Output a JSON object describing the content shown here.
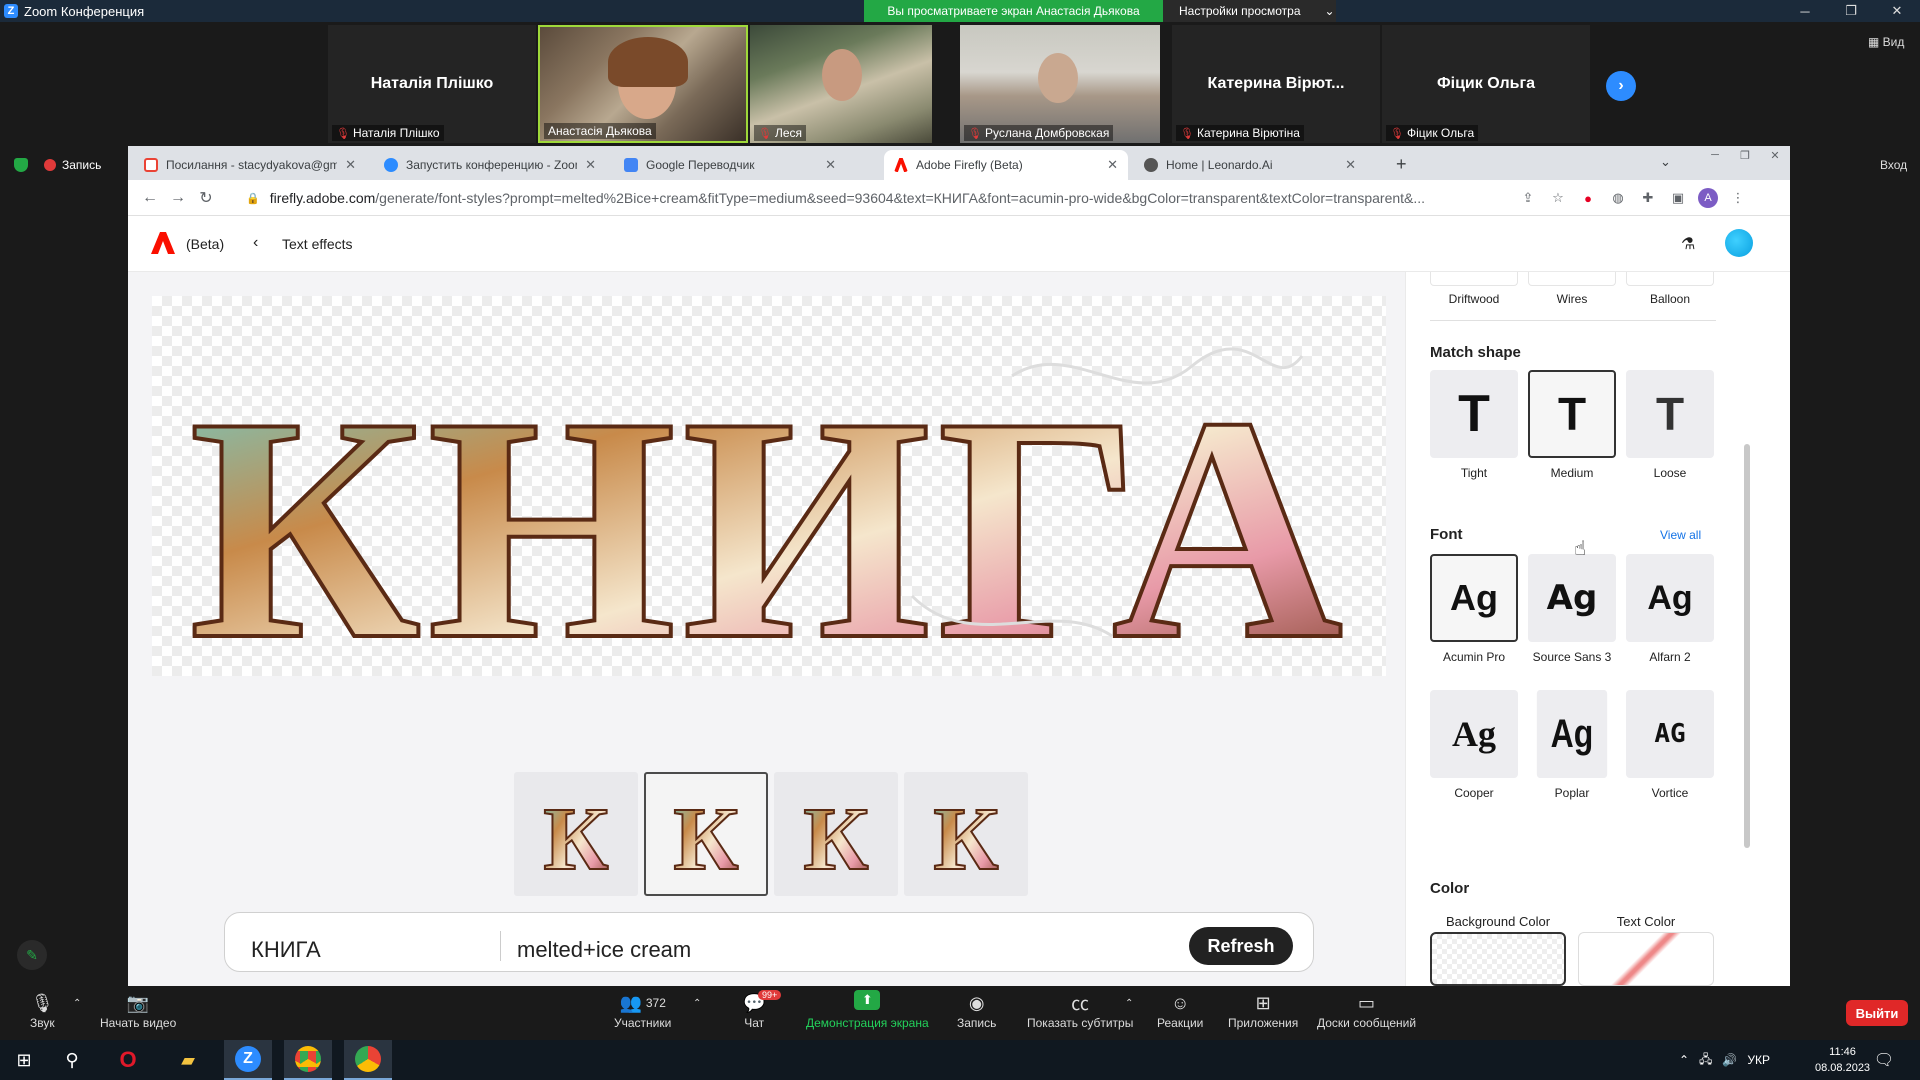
{
  "zoom": {
    "window_title": "Zoom Конференция",
    "share_banner": "Вы просматриваете экран Анастасія Дьякова",
    "view_settings": "Настройки просмотра",
    "view_button": "Вид",
    "recording": "Запись",
    "enter_button": "Вход",
    "participants": [
      {
        "big_name": "Наталія Плішко",
        "name": "Наталія Плішко",
        "video": false
      },
      {
        "big_name": "",
        "name": "Анастасія Дьякова",
        "video": true
      },
      {
        "big_name": "",
        "name": "Леся",
        "video": true
      },
      {
        "big_name": "",
        "name": "Руслана Домбровская",
        "video": true
      },
      {
        "big_name": "Катерина  Вірют...",
        "name": "Катерина Вірютіна",
        "video": false
      },
      {
        "big_name": "Фіцик Ольга",
        "name": "Фіцик Ольга",
        "video": false
      }
    ],
    "toolbar": {
      "audio": "Звук",
      "video": "Начать видео",
      "participants": "Участники",
      "participants_count": "372",
      "chat": "Чат",
      "chat_badge": "99+",
      "share": "Демонстрация экрана",
      "record": "Запись",
      "captions": "Показать субтитры",
      "reactions": "Реакции",
      "apps": "Приложения",
      "whiteboards": "Доски сообщений",
      "leave": "Выйти"
    }
  },
  "browser": {
    "tabs": [
      {
        "label": "Посилання - stacydyakova@gm",
        "color": "#ea4335"
      },
      {
        "label": "Запустить конференцию - Zoom",
        "color": "#2d8cff"
      },
      {
        "label": "Google Переводчик",
        "color": "#4285f4"
      },
      {
        "label": "Adobe Firefly (Beta)",
        "color": "#fa0f00"
      },
      {
        "label": "Home | Leonardo.Ai",
        "color": "#555555"
      }
    ],
    "url_host": "firefly.adobe.com",
    "url_rest": "/generate/font-styles?prompt=melted%2Bice+cream&fitType=medium&seed=93604&text=КНИГА&font=acumin-pro-wide&bgColor=transparent&textColor=transparent&...",
    "profile_initial": "A"
  },
  "firefly": {
    "beta": "(Beta)",
    "breadcrumb": "Text effects",
    "preview_text": "КНИГА",
    "variant_letter": "К",
    "prompt_text": "КНИГА",
    "prompt_style": "melted+ice cream",
    "refresh": "Refresh",
    "top_styles": [
      "Driftwood",
      "Wires",
      "Balloon"
    ],
    "match_shape": {
      "title": "Match shape",
      "options": [
        "Tight",
        "Medium",
        "Loose"
      ],
      "selected": "Medium"
    },
    "font": {
      "title": "Font",
      "view_all": "View all",
      "sample": "Ag",
      "vortice_sample": "AG",
      "options": [
        "Acumin Pro",
        "Source Sans 3",
        "Alfarn 2",
        "Cooper",
        "Poplar",
        "Vortice"
      ],
      "selected": "Acumin Pro"
    },
    "color": {
      "title": "Color",
      "background_label": "Background Color",
      "text_label": "Text Color"
    }
  },
  "taskbar": {
    "lang": "УКР",
    "time": "11:46",
    "date": "08.08.2023"
  }
}
